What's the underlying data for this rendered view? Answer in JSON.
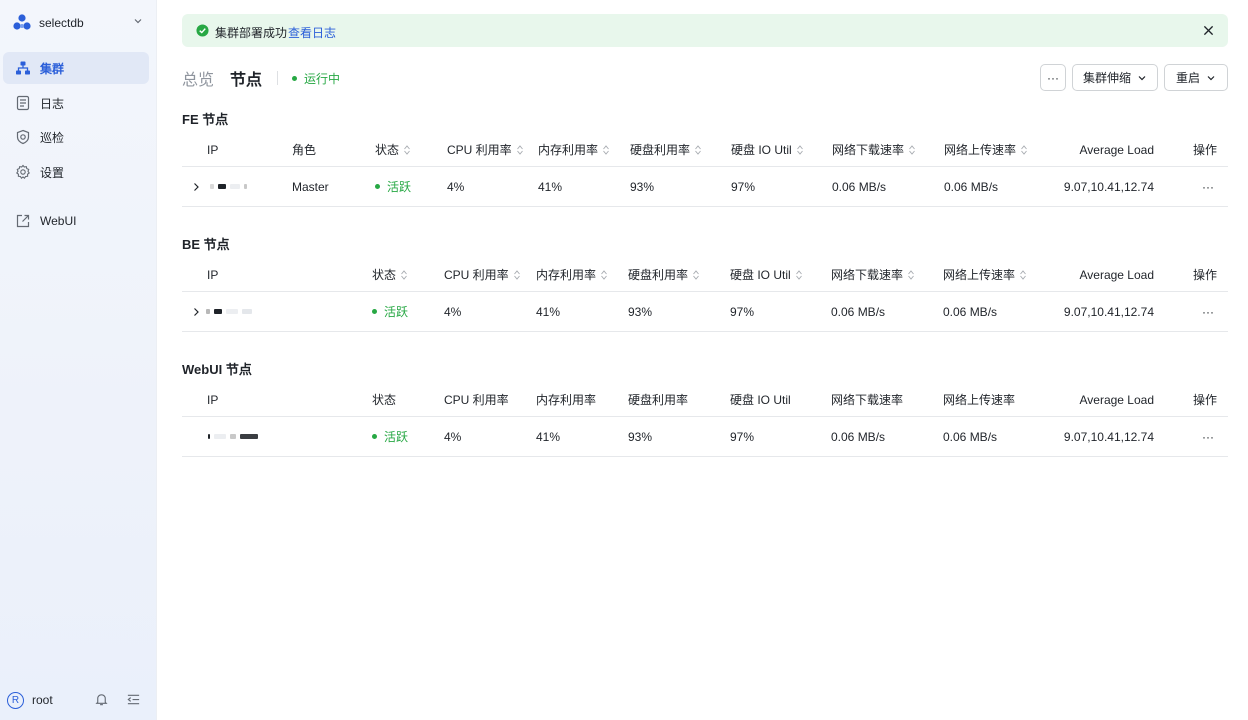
{
  "brand": {
    "name": "selectdb"
  },
  "sidebar": {
    "items": [
      {
        "label": "集群",
        "icon": "cluster-icon",
        "active": true
      },
      {
        "label": "日志",
        "icon": "log-icon",
        "active": false
      },
      {
        "label": "巡检",
        "icon": "inspection-icon",
        "active": false
      },
      {
        "label": "设置",
        "icon": "gear-icon",
        "active": false
      },
      {
        "label": "WebUI",
        "icon": "external-link-icon",
        "active": false
      }
    ],
    "user": {
      "avatar_letter": "R",
      "name": "root"
    }
  },
  "alert": {
    "message": "集群部署成功",
    "link": "查看日志"
  },
  "header": {
    "tabs": [
      {
        "label": "总览"
      },
      {
        "label": "节点"
      }
    ],
    "status": "运行中",
    "buttons": {
      "more": "···",
      "scale": "集群伸缩",
      "restart": "重启"
    }
  },
  "sections": {
    "fe": {
      "title": "FE 节点",
      "columns": [
        "IP",
        "角色",
        "状态",
        "CPU 利用率",
        "内存利用率",
        "硬盘利用率",
        "硬盘 IO Util",
        "网络下载速率",
        "网络上传速率",
        "Average Load",
        "操作"
      ],
      "rows": [
        {
          "role": "Master",
          "status": "活跃",
          "cpu": "4%",
          "mem": "41%",
          "disk": "93%",
          "io": "97%",
          "down": "0.06 MB/s",
          "up": "0.06 MB/s",
          "load": "9.07,10.41,12.74",
          "ops": "···"
        }
      ]
    },
    "be": {
      "title": "BE 节点",
      "columns": [
        "IP",
        "状态",
        "CPU 利用率",
        "内存利用率",
        "硬盘利用率",
        "硬盘 IO Util",
        "网络下载速率",
        "网络上传速率",
        "Average Load",
        "操作"
      ],
      "rows": [
        {
          "status": "活跃",
          "cpu": "4%",
          "mem": "41%",
          "disk": "93%",
          "io": "97%",
          "down": "0.06 MB/s",
          "up": "0.06 MB/s",
          "load": "9.07,10.41,12.74",
          "ops": "···"
        }
      ]
    },
    "webui": {
      "title": "WebUI 节点",
      "columns": [
        "IP",
        "状态",
        "CPU 利用率",
        "内存利用率",
        "硬盘利用率",
        "硬盘 IO Util",
        "网络下载速率",
        "网络上传速率",
        "Average Load",
        "操作"
      ],
      "rows": [
        {
          "status": "活跃",
          "cpu": "4%",
          "mem": "41%",
          "disk": "93%",
          "io": "97%",
          "down": "0.06 MB/s",
          "up": "0.06 MB/s",
          "load": "9.07,10.41,12.74",
          "ops": "···"
        }
      ]
    }
  },
  "colors": {
    "primary": "#2b5fd9",
    "success": "#27a844",
    "alert_bg": "#e8f7ec"
  }
}
